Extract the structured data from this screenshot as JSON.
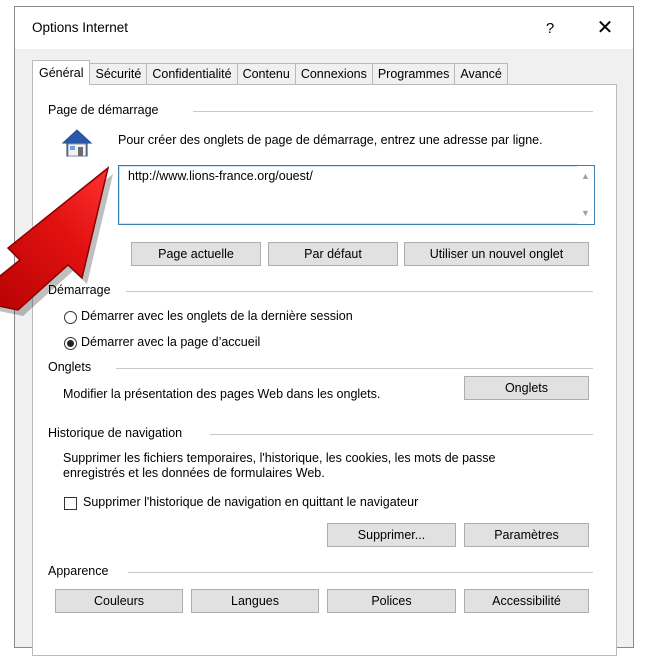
{
  "window": {
    "title": "Options Internet",
    "help_label": "?",
    "close_label": "✕"
  },
  "tabs": [
    {
      "label": "Général",
      "active": true
    },
    {
      "label": "Sécurité"
    },
    {
      "label": "Confidentialité"
    },
    {
      "label": "Contenu"
    },
    {
      "label": "Connexions"
    },
    {
      "label": "Programmes"
    },
    {
      "label": "Avancé"
    }
  ],
  "homepage": {
    "section_label": "Page de démarrage",
    "instruction": "Pour créer des onglets de page de démarrage, entrez une adresse par ligne.",
    "url_value": "http://www.lions-france.org/ouest/",
    "buttons": {
      "current": "Page actuelle",
      "default": "Par défaut",
      "new_tab": "Utiliser un nouvel onglet"
    }
  },
  "startup": {
    "section_label": "Démarrage",
    "option_last_session": "Démarrer avec les onglets de la dernière session",
    "option_home_page": "Démarrer avec la page d’accueil",
    "selected": "home_page"
  },
  "tabs_section": {
    "section_label": "Onglets",
    "description": "Modifier la présentation des pages Web dans les onglets.",
    "button": "Onglets"
  },
  "history": {
    "section_label": "Historique de navigation",
    "description_line1": "Supprimer les fichiers temporaires, l'historique, les cookies, les mots de passe",
    "description_line2": "enregistrés et les données de formulaires Web.",
    "checkbox_label": "Supprimer l'historique de navigation en quittant le navigateur",
    "checkbox_checked": false,
    "delete_button": "Supprimer...",
    "settings_button": "Paramètres"
  },
  "appearance": {
    "section_label": "Apparence",
    "colors": "Couleurs",
    "languages": "Langues",
    "fonts": "Polices",
    "accessibility": "Accessibilité"
  },
  "colors": {
    "arrow_red": "#e01010",
    "input_border": "#3c7fb1",
    "button_bg": "#e1e1e1"
  }
}
